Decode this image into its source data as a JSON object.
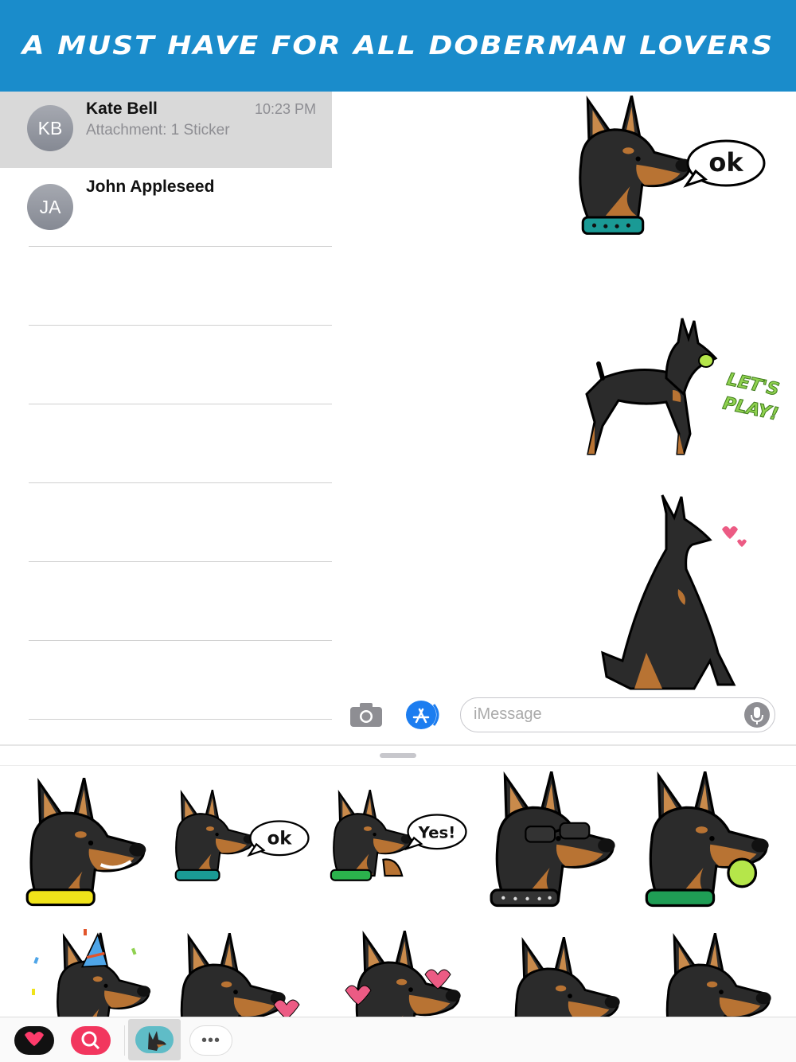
{
  "banner": {
    "text": "A must have for all Doberman lovers"
  },
  "conversations": [
    {
      "initials": "KB",
      "name": "Kate Bell",
      "preview": "Attachment: 1 Sticker",
      "time": "10:23 PM",
      "selected": true
    },
    {
      "initials": "JA",
      "name": "John Appleseed",
      "preview": "",
      "time": "",
      "selected": false
    }
  ],
  "chat": {
    "stickers": [
      {
        "name": "doberman-ok-sticker",
        "speech": "ok"
      },
      {
        "name": "doberman-lets-play-sticker",
        "caption_line1": "LET'S",
        "caption_line2": "PLAY!"
      },
      {
        "name": "doberman-sitting-hearts-sticker"
      }
    ]
  },
  "input": {
    "placeholder": "iMessage",
    "camera_icon": "camera-icon",
    "appstore_icon": "app-store-icon",
    "mic_icon": "microphone-icon"
  },
  "drawer": {
    "stickers_row1": [
      {
        "name": "doberman-smile-sticker",
        "collar": "#f0e31a"
      },
      {
        "name": "doberman-ok-small-sticker",
        "collar": "#1a9a95",
        "speech": "ok"
      },
      {
        "name": "doberman-yes-sticker",
        "collar": "#2bb24c",
        "speech": "Yes!"
      },
      {
        "name": "doberman-sunglasses-sticker",
        "collar": "#333333"
      },
      {
        "name": "doberman-ball-sticker",
        "collar": "#1f9d55"
      }
    ],
    "stickers_row2": [
      {
        "name": "doberman-party-hat-sticker"
      },
      {
        "name": "doberman-heart-sticker"
      },
      {
        "name": "doberman-hearts-tongue-sticker"
      },
      {
        "name": "doberman-head-sticker"
      },
      {
        "name": "doberman-head-2-sticker"
      }
    ]
  },
  "app_strip": [
    {
      "name": "recents-app-icon"
    },
    {
      "name": "image-search-app-icon"
    },
    {
      "name": "doberman-app-icon",
      "selected": true
    },
    {
      "name": "more-apps-icon",
      "label": "•••"
    }
  ],
  "colors": {
    "banner": "#1a8ccb",
    "dog_black": "#2b2b2b",
    "dog_tan": "#b87333",
    "selected_row": "#d9d9d9"
  }
}
